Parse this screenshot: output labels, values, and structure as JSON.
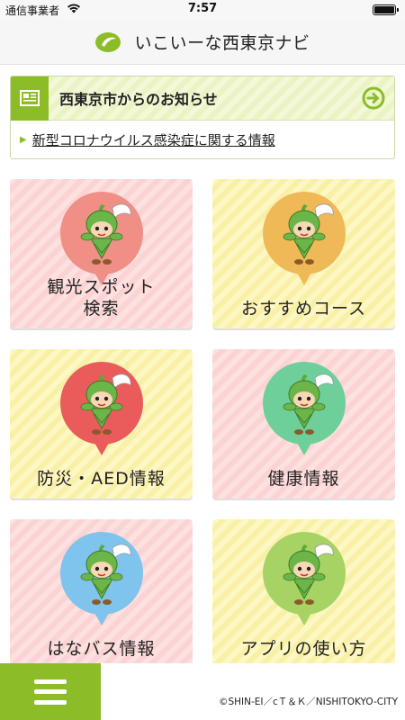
{
  "status_bar": {
    "carrier": "通信事業者",
    "time": "7:57"
  },
  "header": {
    "title": "いこいーな西東京ナビ",
    "logo_icon": "leaf-logo-icon"
  },
  "news": {
    "heading": "西東京市からのお知らせ",
    "items": [
      {
        "label": "新型コロナウイルス感染症に関する情報"
      }
    ]
  },
  "tiles": [
    {
      "label": "観光スポット\n検索",
      "bubble_color": "#ef8f86",
      "style": "pink"
    },
    {
      "label": "おすすめコース",
      "bubble_color": "#f0b957",
      "style": "yellow"
    },
    {
      "label": "防災・AED情報",
      "bubble_color": "#ea5c5c",
      "style": "yellow"
    },
    {
      "label": "健康情報",
      "bubble_color": "#6fcf9a",
      "style": "pink"
    },
    {
      "label": "はなバス情報",
      "bubble_color": "#7fc4ec",
      "style": "pink"
    },
    {
      "label": "アプリの使い方",
      "bubble_color": "#a7d364",
      "style": "yellow"
    }
  ],
  "footer": {
    "copyright": "©SHIN-EI／cＴ＆Ｋ／NISHITOKYO-CITY"
  },
  "colors": {
    "accent_green": "#8cbd28"
  }
}
